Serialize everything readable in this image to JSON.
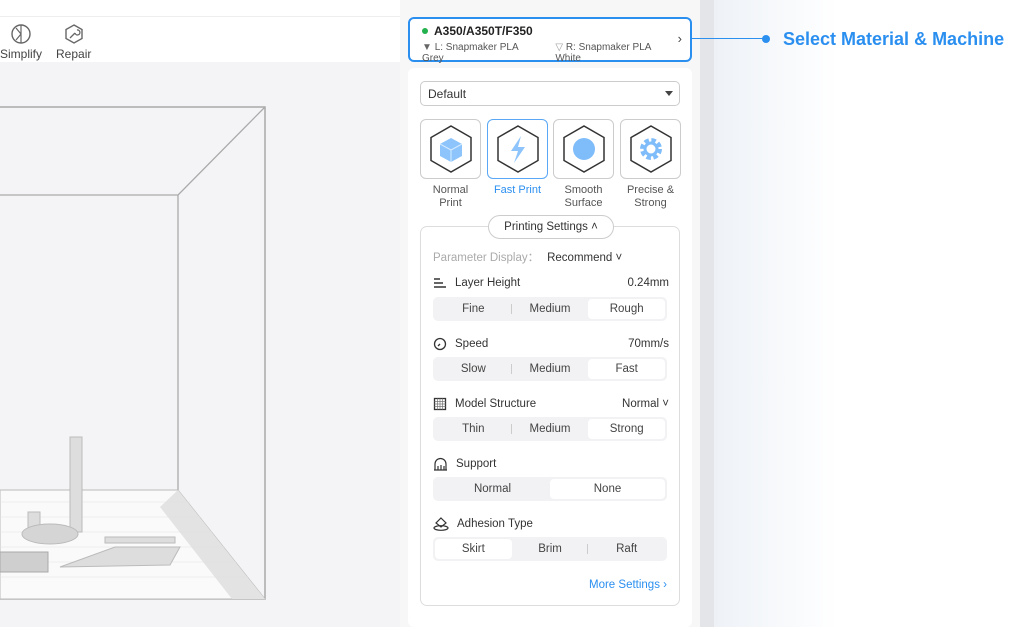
{
  "toolbar": {
    "simplify": "Simplify",
    "repair": "Repair"
  },
  "machine": {
    "name": "A350/A350T/F350",
    "left_material": "L: Snapmaker PLA Grey",
    "right_material": "R: Snapmaker PLA White",
    "status_color": "#22b14c"
  },
  "profile": {
    "selected": "Default"
  },
  "presets": [
    {
      "label": "Normal Print",
      "icon": "cube-icon"
    },
    {
      "label": "Fast Print",
      "icon": "lightning-icon",
      "active": true
    },
    {
      "label": "Smooth Surface",
      "icon": "sphere-icon"
    },
    {
      "label": "Precise & Strong",
      "icon": "gear-icon"
    }
  ],
  "settings": {
    "title": "Printing Settings",
    "param_label": "Parameter Display：",
    "param_value": "Recommend",
    "layer_height": {
      "label": "Layer Height",
      "value": "0.24mm",
      "options": [
        "Fine",
        "Medium",
        "Rough"
      ],
      "selected": "Rough"
    },
    "speed": {
      "label": "Speed",
      "value": "70mm/s",
      "options": [
        "Slow",
        "Medium",
        "Fast"
      ],
      "selected": "Fast"
    },
    "model_structure": {
      "label": "Model Structure",
      "value": "Normal",
      "options": [
        "Thin",
        "Medium",
        "Strong"
      ],
      "selected": "Strong"
    },
    "support": {
      "label": "Support",
      "options": [
        "Normal",
        "None"
      ],
      "selected": "None"
    },
    "adhesion": {
      "label": "Adhesion Type",
      "options": [
        "Skirt",
        "Brim",
        "Raft"
      ],
      "selected": "Skirt"
    },
    "more": "More Settings"
  },
  "callout": {
    "text": "Select Material & Machine",
    "color": "#2b8ff0"
  }
}
